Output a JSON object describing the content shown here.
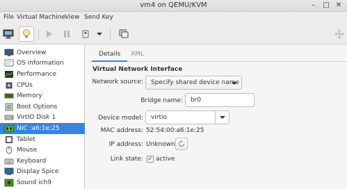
{
  "window": {
    "title": "vm4 on QEMU/KVM",
    "minimize_glyph": "–",
    "maximize_glyph": "□",
    "close_glyph": "✕"
  },
  "menu": {
    "file": "File",
    "virtual_machine": "Virtual Machine",
    "view": "View",
    "send_key": "Send Key"
  },
  "toolbar": {
    "icons": [
      "monitor-icon",
      "lightbulb-icon",
      "play-icon",
      "pause-icon",
      "power-icon",
      "chevron-down-icon",
      "snapshots-icon",
      "fullscreen-icon"
    ]
  },
  "sidebar": {
    "items": [
      {
        "label": "Overview",
        "icon": "overview-icon"
      },
      {
        "label": "OS information",
        "icon": "os-info-icon"
      },
      {
        "label": "Performance",
        "icon": "performance-icon"
      },
      {
        "label": "CPUs",
        "icon": "cpu-icon"
      },
      {
        "label": "Memory",
        "icon": "memory-icon"
      },
      {
        "label": "Boot Options",
        "icon": "boot-options-icon"
      },
      {
        "label": "VirtIO Disk 1",
        "icon": "disk-icon"
      },
      {
        "label": "NIC :a6:1e:25",
        "icon": "nic-icon"
      },
      {
        "label": "Tablet",
        "icon": "tablet-icon"
      },
      {
        "label": "Mouse",
        "icon": "mouse-icon"
      },
      {
        "label": "Keyboard",
        "icon": "keyboard-icon"
      },
      {
        "label": "Display Spice",
        "icon": "display-icon"
      },
      {
        "label": "Sound ich9",
        "icon": "sound-icon"
      }
    ],
    "selected_index": 7
  },
  "tabs": {
    "details": "Details",
    "xml": "XML"
  },
  "nic": {
    "section_title": "Virtual Network Interface",
    "network_source_label": "Network source:",
    "network_source_value": "Specify shared device name",
    "bridge_name_label": "Bridge name:",
    "bridge_name_value": "br0",
    "device_model_label": "Device model:",
    "device_model_value": "virtio",
    "mac_label": "MAC address:",
    "mac_value": "52:54:00:a6:1e:25",
    "ip_label": "IP address:",
    "ip_value": "Unknown",
    "link_state_label": "Link state:",
    "link_state_checked": true,
    "link_state_value": "active"
  },
  "colors": {
    "accent": "#3584e4",
    "window_bg": "#f6f5f4",
    "text": "#2e3436"
  }
}
